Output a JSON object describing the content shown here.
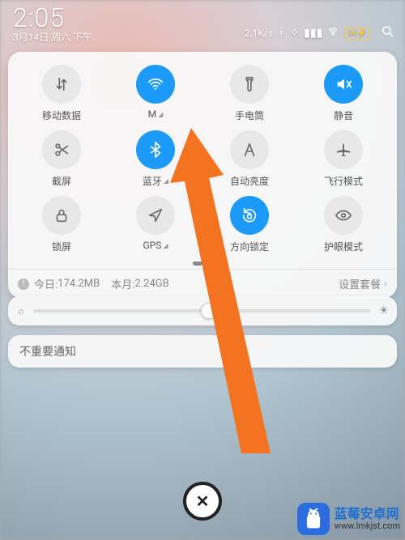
{
  "status": {
    "time": "2:05",
    "date": "3月14日 周六 下午",
    "net_speed": "2.1K/s",
    "battery_percent": "34"
  },
  "tiles": [
    {
      "name": "mobile-data",
      "icon": "arrows-updown",
      "active": false,
      "label": "移动数据",
      "signal": false
    },
    {
      "name": "wifi",
      "icon": "wifi",
      "active": true,
      "label": "M",
      "signal": true
    },
    {
      "name": "flashlight",
      "icon": "flashlight",
      "active": false,
      "label": "手电筒",
      "signal": false
    },
    {
      "name": "mute",
      "icon": "mute",
      "active": true,
      "label": "静音",
      "signal": false
    },
    {
      "name": "screenshot",
      "icon": "scissors",
      "active": false,
      "label": "截屏",
      "signal": false
    },
    {
      "name": "bluetooth",
      "icon": "bluetooth",
      "active": true,
      "label": "蓝牙",
      "signal": true
    },
    {
      "name": "auto-brightness",
      "icon": "letter-a",
      "active": false,
      "label": "自动亮度",
      "signal": false
    },
    {
      "name": "airplane",
      "icon": "airplane",
      "active": false,
      "label": "飞行模式",
      "signal": false
    },
    {
      "name": "lockscreen",
      "icon": "lock",
      "active": false,
      "label": "锁屏",
      "signal": false
    },
    {
      "name": "gps",
      "icon": "location",
      "active": false,
      "label": "GPS",
      "signal": true
    },
    {
      "name": "rotation-lock",
      "icon": "rotation-lock",
      "active": true,
      "label": "方向锁定",
      "signal": false
    },
    {
      "name": "eye-comfort",
      "icon": "eye",
      "active": false,
      "label": "护眼模式",
      "signal": false
    }
  ],
  "data_usage": {
    "today_label": "今日:",
    "today_value": "174.2MB",
    "month_label": "本月:",
    "month_value": "2.24GB",
    "plan_label": "设置套餐"
  },
  "low_priority_label": "不重要通知",
  "watermark": {
    "title": "蓝莓安卓网",
    "url": "www.lmkjst.com"
  },
  "colors": {
    "accent": "#1b9af7",
    "arrow": "#f37321"
  }
}
